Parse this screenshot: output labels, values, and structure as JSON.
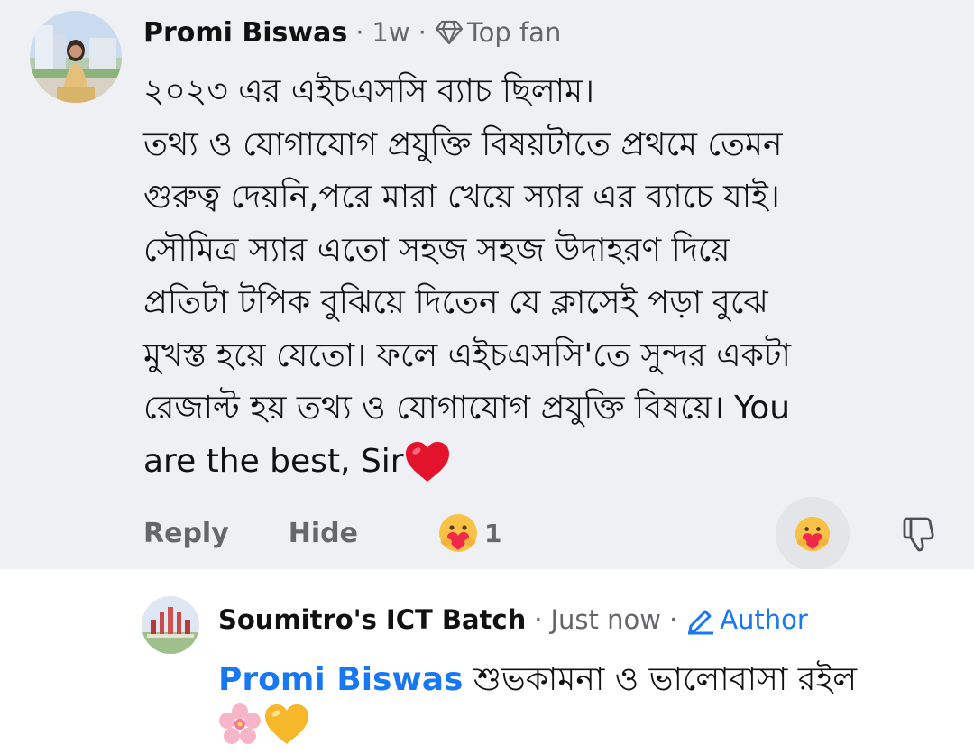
{
  "comment": {
    "author": "Promi Biswas",
    "time": "1w",
    "badge": {
      "label": "Top fan",
      "icon": "diamond-icon"
    },
    "lines": [
      "২০২৩ এর এইচএসসি ব্যাচ ছিলাম।",
      "তথ্য ও যোগাযোগ প্রযুক্তি বিষয়টাতে প্রথমে তেমন",
      "গুরুত্ব দেয়নি,পরে মারা খেয়ে স্যার এর ব্যাচে যাই।",
      "সৌমিত্র স্যার এতো সহজ সহজ উদাহরণ দিয়ে",
      "প্রতিটা টপিক বুঝিয়ে দিতেন যে ক্লাসেই পড়া বুঝে",
      "মুখস্ত হয়ে যেতো। ফলে এইচএসসি'তে সুন্দর একটা",
      "রেজাল্ট হয় তথ্য ও যোগাযোগ প্রযুক্তি বিষয়ে। You",
      "are the best, Sir"
    ],
    "end_emoji": "red-heart-icon",
    "actions": {
      "reply_label": "Reply",
      "hide_label": "Hide"
    },
    "reactions": {
      "icon": "care-reaction-icon",
      "count": "1"
    }
  },
  "reply": {
    "author": "Soumitro's ICT Batch",
    "time": "Just now",
    "badge": {
      "label": "Author",
      "icon": "pencil-icon"
    },
    "mention": "Promi Biswas",
    "text": "শুভকামনা ও ভালোবাসা রইল",
    "emojis": [
      "cherry-blossom-icon",
      "yellow-heart-icon"
    ]
  },
  "colors": {
    "background_comment": "#eff0f3",
    "link_blue": "#1877f2",
    "meta_gray": "#65676b"
  }
}
